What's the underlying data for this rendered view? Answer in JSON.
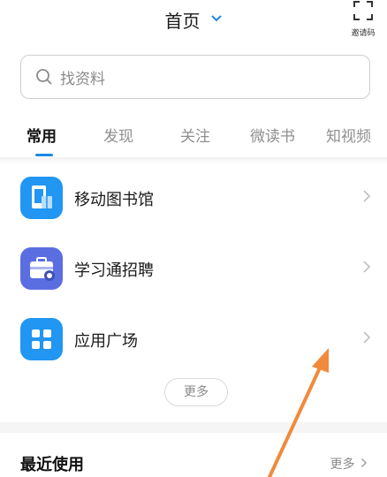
{
  "header": {
    "title": "首页",
    "invite_label": "邀请码"
  },
  "search": {
    "placeholder": "找资料"
  },
  "tabs": [
    {
      "label": "常用",
      "active": true
    },
    {
      "label": "发现",
      "active": false
    },
    {
      "label": "关注",
      "active": false
    },
    {
      "label": "微读书",
      "active": false
    },
    {
      "label": "知视频",
      "active": false
    }
  ],
  "apps": [
    {
      "label": "移动图书馆",
      "icon": "mobile-library-icon",
      "color": "#2196f3"
    },
    {
      "label": "学习通招聘",
      "icon": "briefcase-icon",
      "color": "#5b6ee1"
    },
    {
      "label": "应用广场",
      "icon": "app-grid-icon",
      "color": "#2196f3"
    }
  ],
  "more_button": "更多",
  "recent": {
    "title": "最近使用",
    "more": "更多"
  },
  "colors": {
    "accent": "#1e88e5",
    "annotation_arrow": "#f08a3c"
  }
}
